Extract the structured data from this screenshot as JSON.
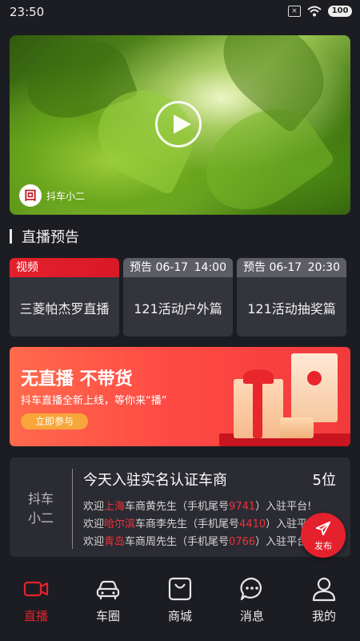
{
  "status_bar": {
    "time": "23:50",
    "battery": "100"
  },
  "video": {
    "channel_name": "抖车小二",
    "channel_logo_text": "回"
  },
  "section": {
    "title": "直播预告"
  },
  "previews": [
    {
      "tag": "视频",
      "time": "",
      "title": "三菱帕杰罗直播",
      "color": "#e51f2c"
    },
    {
      "tag": "预告 06-17",
      "time": "14:00",
      "title": "121活动户外篇"
    },
    {
      "tag": "预告 06-17",
      "time": "20:30",
      "title": "121活动抽奖篇"
    }
  ],
  "banner": {
    "title": "无直播 不带货",
    "subtitle": "抖车直播全新上线，等你来“播”",
    "button": "立即参与"
  },
  "info": {
    "left_line1": "抖车",
    "left_line2": "小二",
    "headline": "今天入驻实名认证车商",
    "count": "5位",
    "welcomes": [
      {
        "pre": "欢迎",
        "city": "上海",
        "mid": "车商黄先生（手机尾号",
        "tail": "9741",
        "post": "）入驻平台!"
      },
      {
        "pre": "欢迎",
        "city": "哈尔滨",
        "mid": "车商李先生（手机尾号",
        "tail": "4410",
        "post": "）入驻平台!"
      },
      {
        "pre": "欢迎",
        "city": "青岛",
        "mid": "车商周先生（手机尾号",
        "tail": "0766",
        "post": "）入驻平台!"
      }
    ]
  },
  "fab": {
    "label": "发布"
  },
  "tabs": [
    {
      "label": "直播",
      "icon": "video-camera-icon"
    },
    {
      "label": "车圈",
      "icon": "car-icon"
    },
    {
      "label": "商城",
      "icon": "shopping-bag-icon"
    },
    {
      "label": "消息",
      "icon": "chat-bubble-icon"
    },
    {
      "label": "我的",
      "icon": "person-icon"
    }
  ],
  "colors": {
    "accent": "#e5212d",
    "background": "#1c1d22",
    "card": "#33343c"
  }
}
